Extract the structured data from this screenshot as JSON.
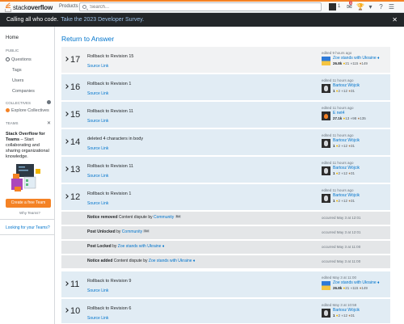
{
  "topbar": {
    "logo_prefix": "stack",
    "logo_suffix": "overflow",
    "products_label": "Products",
    "search_placeholder": "Search...",
    "rep": "1",
    "inbox_count": "3"
  },
  "banner": {
    "text": "Calling all who code.",
    "link": "Take the 2023 Developer Survey.",
    "close": "✕"
  },
  "sidebar": {
    "home": "Home",
    "public_heading": "PUBLIC",
    "questions": "Questions",
    "tags": "Tags",
    "users": "Users",
    "companies": "Companies",
    "collectives_heading": "COLLECTIVES",
    "explore_collectives": "Explore Collectives",
    "teams_heading": "TEAMS",
    "teams_close": "✕",
    "teams_title": "Stack Overflow for Teams",
    "teams_desc": " – Start collaborating and sharing organizational knowledge.",
    "teams_button": "Create a free Team",
    "why_teams": "Why Teams?",
    "looking": "Looking for your Teams?"
  },
  "main": {
    "return_link": "Return to Answer",
    "revisions": [
      {
        "num": "17",
        "comment": "Rollback to Revision 15",
        "source": "Source",
        "link": "Link",
        "time": "edited 9 hours ago",
        "user": "Zoe stands with Ukraine ♦",
        "rep": "26.8k",
        "gold": "21",
        "silver": "115",
        "bronze": "149",
        "avatar": "ukr",
        "style": "light"
      },
      {
        "num": "16",
        "comment": "Rollback to Revision 1",
        "source": "Source",
        "link": "Link",
        "time": "edited 11 hours ago",
        "user": "Bartosz Wójcik",
        "rep": "1",
        "gold": "2",
        "silver": "12",
        "bronze": "31",
        "avatar": "owl",
        "style": "blue"
      },
      {
        "num": "15",
        "comment": "Rollback to Revision 11",
        "source": "Source",
        "link": "Link",
        "time": "edited 11 hours ago",
        "user": "E net4",
        "rep": "27.1k",
        "gold": "13",
        "silver": "98",
        "bronze": "135",
        "avatar": "fire",
        "style": "blue"
      },
      {
        "num": "14",
        "comment": "deleted 4 characters in body",
        "source": "Source",
        "link": "Link",
        "time": "edited 11 hours ago",
        "user": "Bartosz Wójcik",
        "rep": "1",
        "gold": "2",
        "silver": "12",
        "bronze": "31",
        "avatar": "owl",
        "style": "blue"
      },
      {
        "num": "13",
        "comment": "Rollback to Revision 11",
        "source": "Source",
        "link": "Link",
        "time": "edited 11 hours ago",
        "user": "Bartosz Wójcik",
        "rep": "1",
        "gold": "2",
        "silver": "12",
        "bronze": "31",
        "avatar": "owl",
        "style": "blue"
      },
      {
        "num": "12",
        "comment": "Rollback to Revision 1",
        "source": "Source",
        "link": "Link",
        "time": "edited 11 hours ago",
        "user": "Bartosz Wójcik",
        "rep": "1",
        "gold": "2",
        "silver": "12",
        "bronze": "31",
        "avatar": "owl",
        "style": "blue"
      },
      {
        "num": "11",
        "comment": "Rollback to Revision 9",
        "source": "Source",
        "link": "Link",
        "time": "edited May 3 at 11:00",
        "user": "Zoe stands with Ukraine ♦",
        "rep": "26.8k",
        "gold": "21",
        "silver": "115",
        "bronze": "149",
        "avatar": "ukr",
        "style": "blue"
      },
      {
        "num": "10",
        "comment": "Rollback to Revision 6",
        "source": "Source",
        "link": "Link",
        "time": "edited May 3 at 10:58",
        "user": "Bartosz Wójcik",
        "rep": "1",
        "gold": "2",
        "silver": "12",
        "bronze": "31",
        "avatar": "owl",
        "style": "blue"
      }
    ],
    "notices": [
      {
        "action": "Notice removed",
        "rest": " Content dispute by ",
        "user": "Community",
        "bot": "Bot",
        "time": "occurred May 3 at 12:01"
      },
      {
        "action": "Post Unlocked",
        "rest": " by ",
        "user": "Community",
        "bot": "Bot",
        "time": "occurred May 3 at 12:01"
      },
      {
        "action": "Post Locked",
        "rest": " by ",
        "user": "Zoe stands with Ukraine ♦",
        "bot": "",
        "time": "occurred May 3 at 11:00"
      },
      {
        "action": "Notice added",
        "rest": " Content dispute by ",
        "user": "Zoe stands with Ukraine ♦",
        "bot": "",
        "time": "occurred May 3 at 11:00"
      }
    ]
  }
}
